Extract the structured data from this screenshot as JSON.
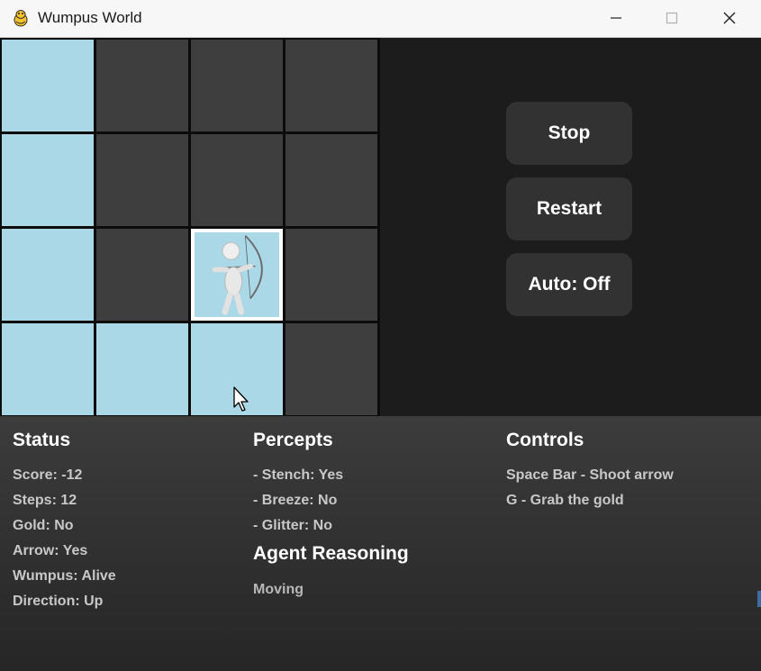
{
  "window": {
    "title": "Wumpus World"
  },
  "board": {
    "rows": 4,
    "cols": 4,
    "cells": [
      [
        "visited",
        "unvisited",
        "unvisited",
        "unvisited"
      ],
      [
        "visited",
        "unvisited",
        "unvisited",
        "unvisited"
      ],
      [
        "visited",
        "unvisited",
        "agent",
        "unvisited"
      ],
      [
        "visited",
        "visited",
        "visited",
        "unvisited"
      ]
    ],
    "agent": {
      "row": 2,
      "col": 2,
      "icon": "archer-icon"
    },
    "colors": {
      "visited": "#aad8e6",
      "unvisited": "#3e3e3e",
      "grid": "#0c0c0c"
    }
  },
  "controls_panel": {
    "stop_label": "Stop",
    "restart_label": "Restart",
    "auto_label": "Auto: Off"
  },
  "status": {
    "heading": "Status",
    "score": "Score: -12",
    "steps": "Steps: 12",
    "gold": "Gold: No",
    "arrow": "Arrow: Yes",
    "wumpus": "Wumpus: Alive",
    "direction": "Direction: Up"
  },
  "percepts": {
    "heading": "Percepts",
    "stench": "- Stench: Yes",
    "breeze": "- Breeze: No",
    "glitter": "- Glitter: No"
  },
  "reasoning": {
    "heading": "Agent Reasoning",
    "text": "Moving"
  },
  "help": {
    "heading": "Controls",
    "shoot": "Space Bar - Shoot arrow",
    "grab": "G - Grab the gold"
  }
}
